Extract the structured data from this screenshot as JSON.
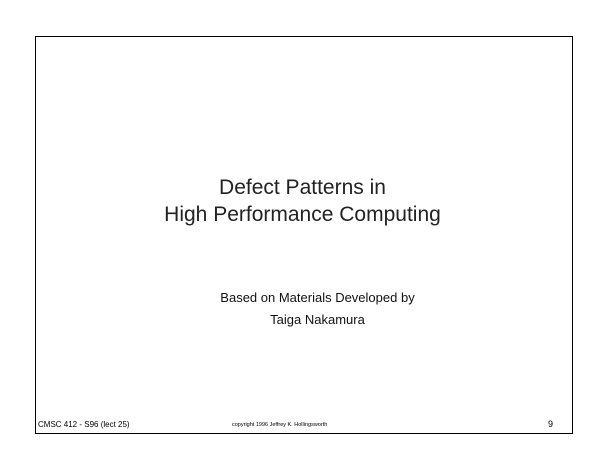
{
  "slide": {
    "title_lines": [
      "Defect Patterns in",
      "High Performance Computing"
    ],
    "subtitle_lines": [
      "Based on Materials Developed by",
      "Taiga Nakamura"
    ]
  },
  "footer": {
    "course": "CMSC 412 - S96 (lect 25)",
    "copyright": "copyright 1996 Jeffrey K. Hollingsworth",
    "page_number": "9"
  }
}
